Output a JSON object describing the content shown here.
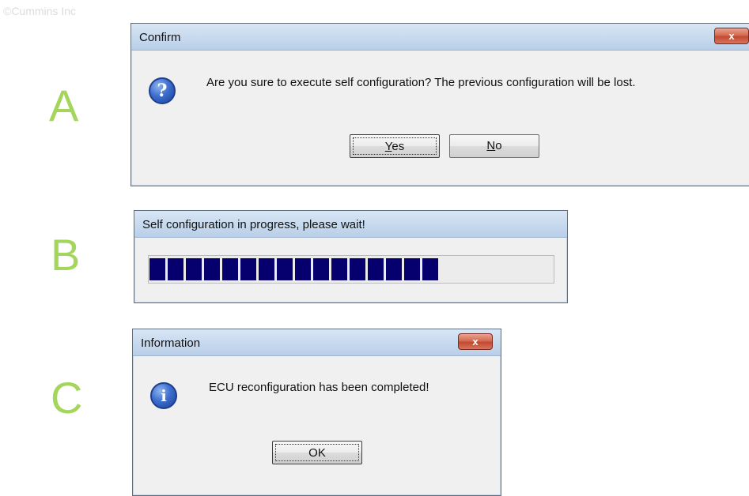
{
  "watermark": "©Cummins Inc",
  "steps": {
    "a": "A",
    "b": "B",
    "c": "C"
  },
  "confirm_dialog": {
    "title": "Confirm",
    "close_label": "x",
    "icon": "question-icon",
    "icon_glyph": "?",
    "message": "Are you sure to execute self configuration? The previous configuration will be lost.",
    "yes_mnemonic": "Y",
    "yes_rest": "es",
    "no_mnemonic": "N",
    "no_rest": "o"
  },
  "progress_dialog": {
    "title": "Self configuration in progress, please wait!",
    "progress": 0.72,
    "colors": {
      "fill": "#06006e",
      "track": "#ececec"
    }
  },
  "info_dialog": {
    "title": "Information",
    "close_label": "x",
    "icon": "info-icon",
    "icon_glyph": "i",
    "message": "ECU reconfiguration has been completed!",
    "ok_label": "OK"
  },
  "colors": {
    "step_letters": "#a3d65a",
    "close_button": "#c14a30",
    "titlebar": "#c6d9ee"
  }
}
